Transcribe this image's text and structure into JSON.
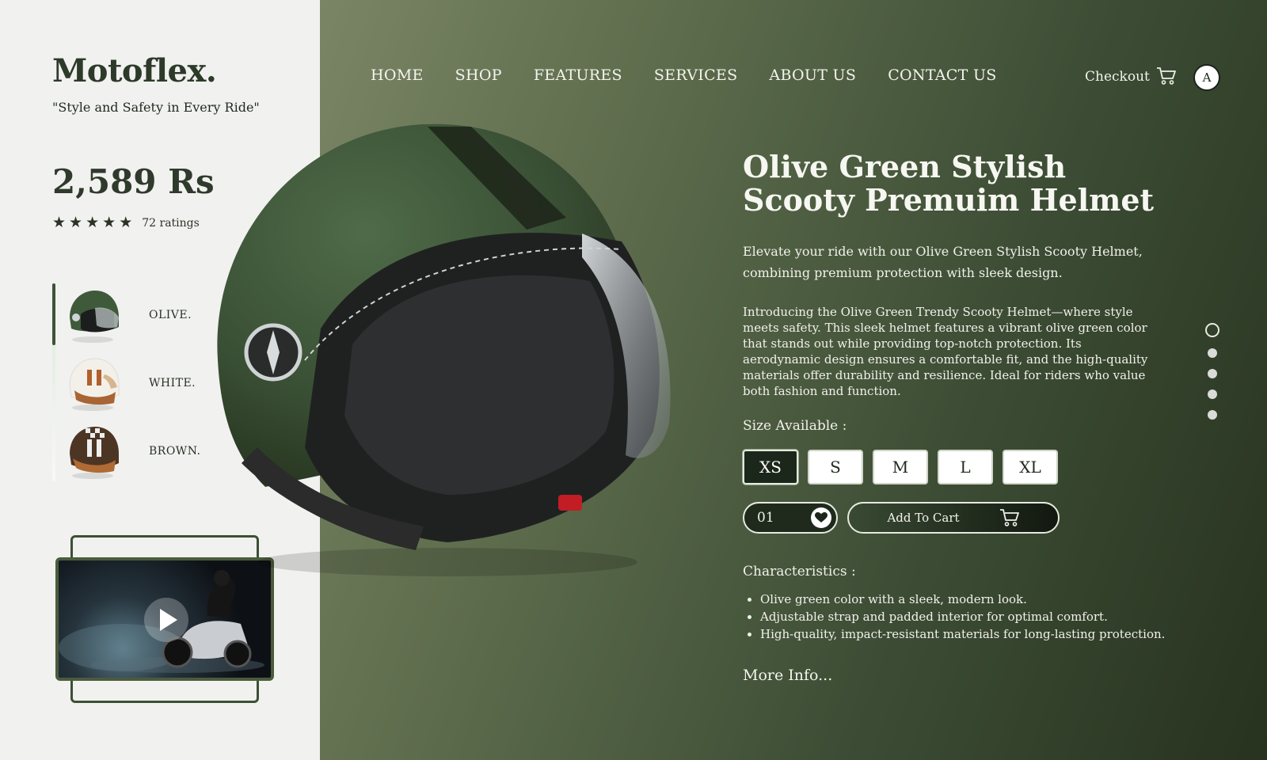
{
  "brand": {
    "logo": "Motoflex.",
    "tagline": "\"Style and Safety in Every Ride\""
  },
  "product": {
    "price": "2,589 Rs",
    "rating": 5,
    "ratings_count": "72 ratings",
    "title": "Olive Green Stylish Scooty Premuim Helmet",
    "lead": "Elevate your ride with our Olive Green Stylish Scooty Helmet, combining premium protection with sleek design.",
    "description": "Introducing the Olive Green Trendy Scooty Helmet—where style meets safety. This sleek helmet features a vibrant olive green color that stands out while providing top-notch protection. Its aerodynamic design ensures a comfortable fit, and the high-quality materials offer durability and resilience. Ideal for riders who value both fashion and function.",
    "size_label": "Size Available :",
    "sizes": [
      "XS",
      "S",
      "M",
      "L",
      "XL"
    ],
    "selected_size": "XS",
    "quantity": "01",
    "add_to_cart": "Add To Cart",
    "characteristics_label": "Characteristics :",
    "characteristics": [
      "Olive green color with a sleek, modern look.",
      "Adjustable strap and padded interior for optimal comfort.",
      "High-quality, impact-resistant materials for long-lasting protection."
    ],
    "more_info": "More Info..."
  },
  "variants": [
    {
      "label": "OLIVE.",
      "color": "#3f5a3a"
    },
    {
      "label": "WHITE.",
      "color": "#f1ede6"
    },
    {
      "label": "BROWN.",
      "color": "#6b4a2e"
    }
  ],
  "nav": [
    "HOME",
    "SHOP",
    "FEATURES",
    "SERVICES",
    "ABOUT US",
    "CONTACT US"
  ],
  "header": {
    "checkout": "Checkout",
    "avatar_initial": "A"
  },
  "icons": {
    "cart": "cart-icon",
    "heart": "heart-icon",
    "play": "play-icon",
    "star": "star-icon"
  },
  "colors": {
    "accent_dark": "#1c271b",
    "panel_green": "#5d6c4c",
    "panel_light": "#f1f1f0"
  },
  "pager": {
    "count": 5,
    "active_index": 0
  }
}
